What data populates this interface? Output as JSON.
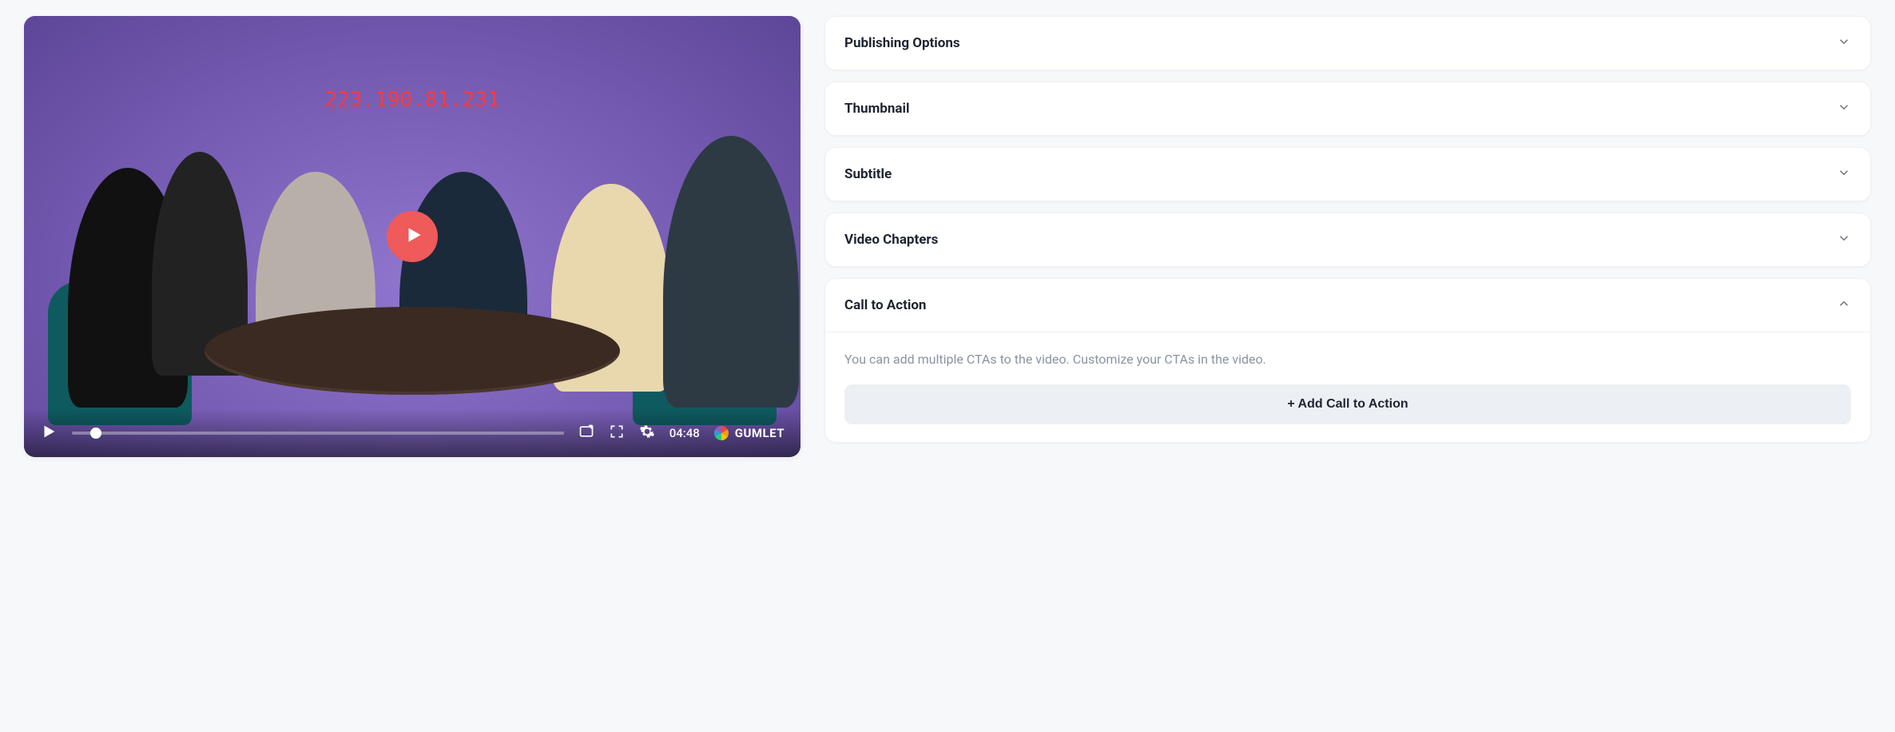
{
  "video": {
    "watermark": "223.190.81.231",
    "duration_display": "04:48",
    "brand_name": "GUMLET"
  },
  "panels": {
    "publishing": {
      "title": "Publishing Options"
    },
    "thumbnail": {
      "title": "Thumbnail"
    },
    "subtitle": {
      "title": "Subtitle"
    },
    "chapters": {
      "title": "Video Chapters"
    },
    "cta": {
      "title": "Call to Action",
      "help": "You can add multiple CTAs to the video. Customize your CTAs in the video.",
      "add_label": "+ Add Call to Action"
    }
  }
}
